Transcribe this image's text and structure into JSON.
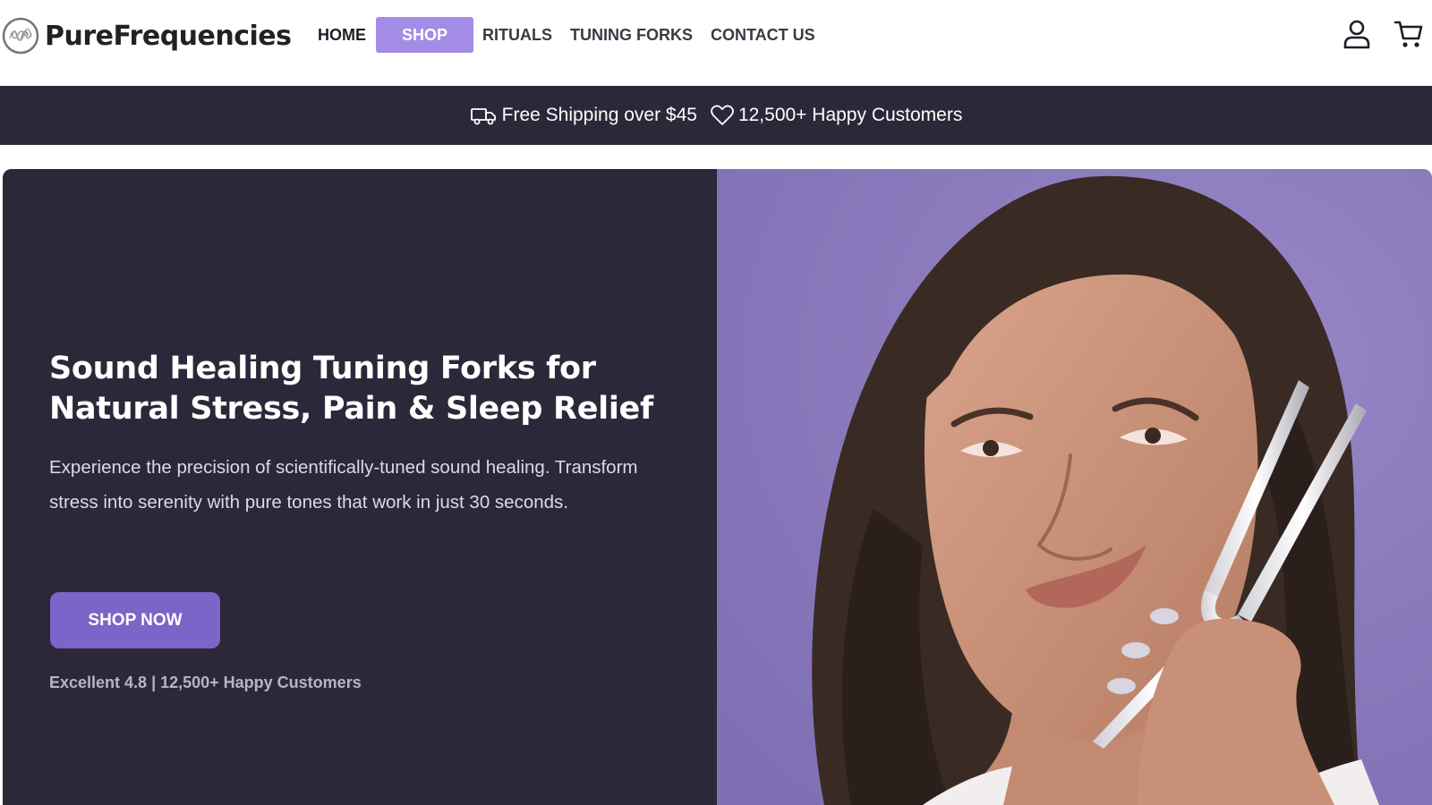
{
  "brand": {
    "name": "PureFrequencies",
    "logo_icon": "sound-wave-logo-icon"
  },
  "nav": {
    "items": [
      {
        "label": "HOME",
        "active": false
      },
      {
        "label": "SHOP",
        "active": true
      },
      {
        "label": "RITUALS",
        "active": false
      },
      {
        "label": "TUNING FORKS",
        "active": false
      },
      {
        "label": "CONTACT US",
        "active": false
      }
    ]
  },
  "header_icons": {
    "account": "user-icon",
    "cart": "cart-icon"
  },
  "announcement": {
    "shipping_text": "Free Shipping over $45",
    "shipping_icon": "truck-icon",
    "customers_text": "12,500+ Happy Customers",
    "customers_icon": "heart-icon"
  },
  "hero": {
    "title_line1": "Sound Healing Tuning Forks for",
    "title_line2": "Natural Stress, Pain & Sleep Relief",
    "subtitle": "Experience the precision of scientifically-tuned sound healing. Transform stress into serenity with pure tones that work in just 30 seconds.",
    "cta_label": "SHOP NOW",
    "rating_text": "Excellent 4.8 | 12,500+ Happy Customers",
    "image": "woman-holding-tuning-fork-photo"
  },
  "colors": {
    "accent": "#a38ce6",
    "cta": "#7a65c8",
    "dark_bg": "#2d2839",
    "photo_bg": "#8b7bbd",
    "text_dark": "#1e1e28"
  }
}
